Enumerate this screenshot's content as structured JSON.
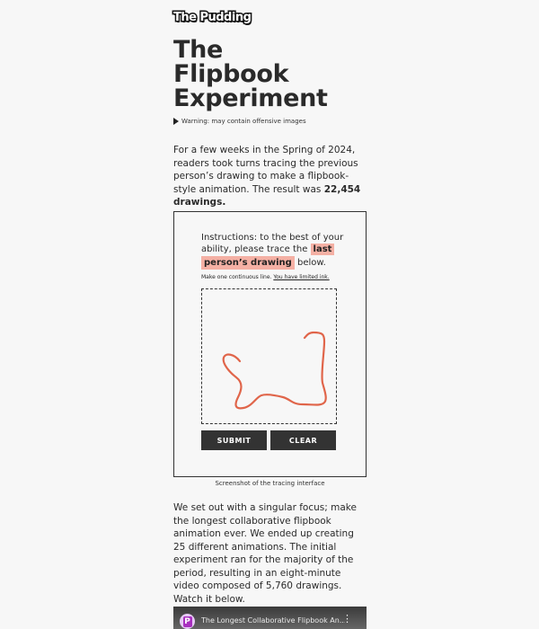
{
  "logo": "The Pudding",
  "title_lines": [
    "The",
    "Flipbook",
    "Experiment"
  ],
  "warning": "Warning: may contain offensive images",
  "intro": {
    "text": "For a few weeks in the Spring of 2024, readers took turns tracing the previous person’s drawing to make a flipbook-style animation. The result was ",
    "bold": "22,454 drawings."
  },
  "interface": {
    "instructions_prefix": "Instructions: to the best of your ability, please trace the ",
    "highlight_1": "last",
    "highlight_2": "person’s drawing",
    "instructions_suffix": " below.",
    "small_prefix": "Make one continuous line. ",
    "small_link": "You have limited ink.",
    "submit_label": "SUBMIT",
    "clear_label": "CLEAR",
    "stroke_color": "#e0654a"
  },
  "caption": "Screenshot of the tracing interface",
  "body2": "We set out with a singular focus; make the longest collaborative flipbook animation ever. We ended up creating 25 different animations. The initial experiment ran for the majority of the period, resulting in an eight-minute video composed of 5,760 drawings. Watch it below.",
  "video": {
    "title": "The Longest Collaborative Flipbook An...",
    "avatar_letter": "P",
    "menu_icon": "⋮"
  }
}
